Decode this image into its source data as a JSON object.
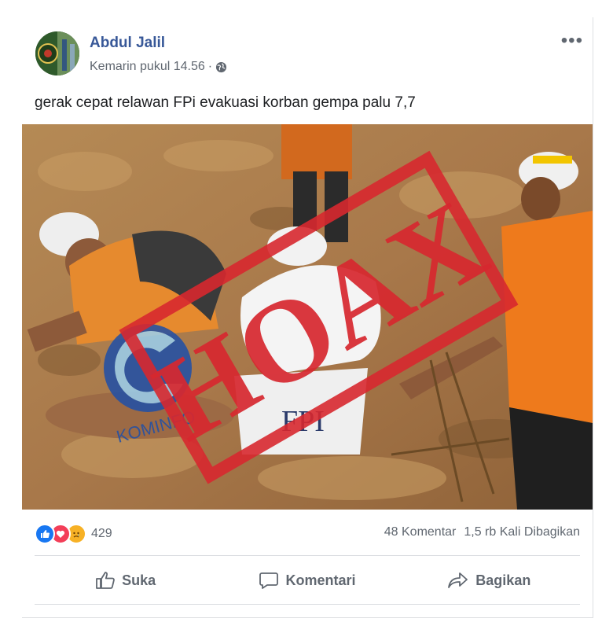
{
  "post": {
    "author": "Abdul Jalil",
    "timestamp": "Kemarin pukul 14.56",
    "separator": "·",
    "more_icon": "•••",
    "text": "gerak cepat relawan FPi evakuasi korban gempa palu 7,7"
  },
  "photo": {
    "stamp_text": "HOAX",
    "watermark_text": "KOMINFO",
    "vest_text": "FPI"
  },
  "stats": {
    "reaction_count": "429",
    "comments": "48 Komentar",
    "shares": "1,5 rb Kali Dibagikan"
  },
  "actions": {
    "like": "Suka",
    "comment": "Komentari",
    "share": "Bagikan"
  },
  "colors": {
    "author_link": "#385898",
    "secondary_text": "#606770",
    "stamp_red": "#d7282f",
    "kominfo_blue": "#1f4fa8"
  }
}
